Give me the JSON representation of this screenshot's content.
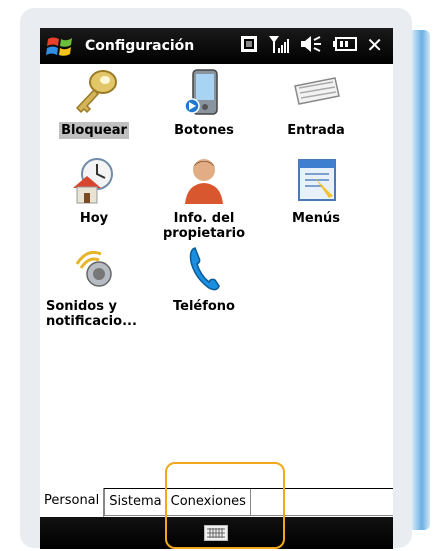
{
  "titlebar": {
    "title": "Configuración"
  },
  "items": [
    {
      "label": "Bloquear",
      "icon": "key-icon"
    },
    {
      "label": "Botones",
      "icon": "device-button-icon"
    },
    {
      "label": "Entrada",
      "icon": "keyboard-icon"
    },
    {
      "label": "Hoy",
      "icon": "home-clock-icon"
    },
    {
      "label": "Info. del propietario",
      "icon": "owner-icon"
    },
    {
      "label": "Menús",
      "icon": "menu-window-icon"
    },
    {
      "label": "Sonidos y notificacio...",
      "icon": "speaker-icon"
    },
    {
      "label": "Teléfono",
      "icon": "phone-icon"
    }
  ],
  "tabs": [
    "Personal",
    "Sistema",
    "Conexiones"
  ],
  "colors": {
    "highlight": "#f2a81d",
    "selected_label_bg": "#c0c0c0",
    "titlebar": "#000000"
  }
}
